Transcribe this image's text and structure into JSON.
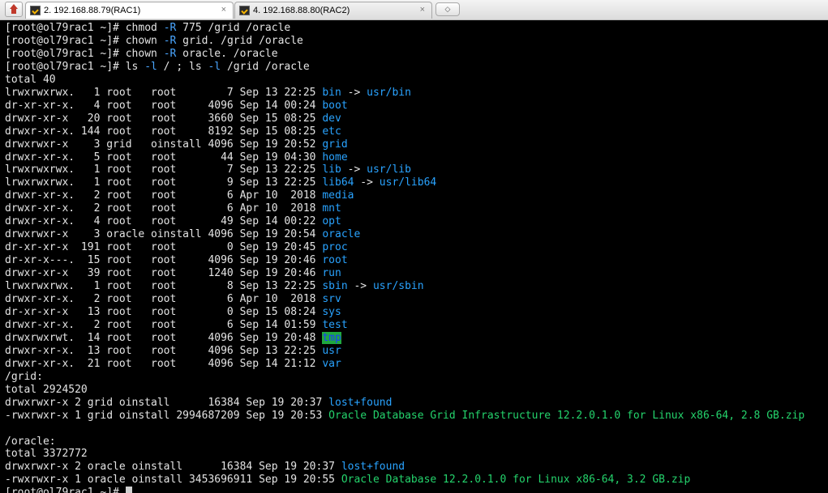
{
  "tabs": [
    {
      "label": "2. 192.168.88.79(RAC1)",
      "close": "×",
      "active": true
    },
    {
      "label": "4. 192.168.88.80(RAC2)",
      "close": "×",
      "active": false
    }
  ],
  "new_tab": "◇",
  "terminal": {
    "prompt": "[root@ol79rac1 ~]# ",
    "commands": [
      {
        "pre": "chmod ",
        "flag": "-R",
        "post": " 775 /grid /oracle"
      },
      {
        "pre": "chown ",
        "flag": "-R",
        "post": " grid. /grid /oracle"
      },
      {
        "pre": "chown ",
        "flag": "-R",
        "post": " oracle. /oracle"
      },
      {
        "pre": "ls ",
        "flag": "-l",
        "mid": " / ; ls ",
        "flag2": "-l",
        "post": " /grid /oracle"
      }
    ],
    "root_total": "total 40",
    "root_listing": [
      {
        "meta": "lrwxrwxrwx.   1 root   root        7 Sep 13 22:25 ",
        "name": "bin",
        "arrow": " -> ",
        "target": "usr/bin"
      },
      {
        "meta": "dr-xr-xr-x.   4 root   root     4096 Sep 14 00:24 ",
        "name": "boot"
      },
      {
        "meta": "drwxr-xr-x   20 root   root     3660 Sep 15 08:25 ",
        "name": "dev"
      },
      {
        "meta": "drwxr-xr-x. 144 root   root     8192 Sep 15 08:25 ",
        "name": "etc"
      },
      {
        "meta": "drwxrwxr-x    3 grid   oinstall 4096 Sep 19 20:52 ",
        "name": "grid"
      },
      {
        "meta": "drwxr-xr-x.   5 root   root       44 Sep 19 04:30 ",
        "name": "home"
      },
      {
        "meta": "lrwxrwxrwx.   1 root   root        7 Sep 13 22:25 ",
        "name": "lib",
        "arrow": " -> ",
        "target": "usr/lib"
      },
      {
        "meta": "lrwxrwxrwx.   1 root   root        9 Sep 13 22:25 ",
        "name": "lib64",
        "arrow": " -> ",
        "target": "usr/lib64"
      },
      {
        "meta": "drwxr-xr-x.   2 root   root        6 Apr 10  2018 ",
        "name": "media"
      },
      {
        "meta": "drwxr-xr-x.   2 root   root        6 Apr 10  2018 ",
        "name": "mnt"
      },
      {
        "meta": "drwxr-xr-x.   4 root   root       49 Sep 14 00:22 ",
        "name": "opt"
      },
      {
        "meta": "drwxrwxr-x    3 oracle oinstall 4096 Sep 19 20:54 ",
        "name": "oracle"
      },
      {
        "meta": "dr-xr-xr-x  191 root   root        0 Sep 19 20:45 ",
        "name": "proc"
      },
      {
        "meta": "dr-xr-x---.  15 root   root     4096 Sep 19 20:46 ",
        "name": "root"
      },
      {
        "meta": "drwxr-xr-x   39 root   root     1240 Sep 19 20:46 ",
        "name": "run"
      },
      {
        "meta": "lrwxrwxrwx.   1 root   root        8 Sep 13 22:25 ",
        "name": "sbin",
        "arrow": " -> ",
        "target": "usr/sbin"
      },
      {
        "meta": "drwxr-xr-x.   2 root   root        6 Apr 10  2018 ",
        "name": "srv"
      },
      {
        "meta": "dr-xr-xr-x   13 root   root        0 Sep 15 08:24 ",
        "name": "sys"
      },
      {
        "meta": "drwxr-xr-x.   2 root   root        6 Sep 14 01:59 ",
        "name": "test"
      },
      {
        "meta": "drwxrwxrwt.  14 root   root     4096 Sep 19 20:48 ",
        "name": "tmp",
        "sticky": true
      },
      {
        "meta": "drwxr-xr-x.  13 root   root     4096 Sep 13 22:25 ",
        "name": "usr"
      },
      {
        "meta": "drwxr-xr-x.  21 root   root     4096 Sep 14 21:12 ",
        "name": "var"
      }
    ],
    "grid_header": "/grid:",
    "grid_total": "total 2924520",
    "grid_listing": [
      {
        "meta": "drwxrwxr-x 2 grid oinstall      16384 Sep 19 20:37 ",
        "name": "lost+found",
        "kind": "dir"
      },
      {
        "meta": "-rwxrwxr-x 1 grid oinstall 2994687209 Sep 19 20:53 ",
        "name": "Oracle Database Grid Infrastructure 12.2.0.1.0 for Linux x86-64, 2.8 GB.zip",
        "kind": "zip"
      }
    ],
    "oracle_header": "/oracle:",
    "oracle_total": "total 3372772",
    "oracle_listing": [
      {
        "meta": "drwxrwxr-x 2 oracle oinstall      16384 Sep 19 20:37 ",
        "name": "lost+found",
        "kind": "dir"
      },
      {
        "meta": "-rwxrwxr-x 1 oracle oinstall 3453696911 Sep 19 20:55 ",
        "name": "Oracle Database 12.2.0.1.0 for Linux x86-64, 3.2 GB.zip",
        "kind": "zip"
      }
    ]
  },
  "colors": {
    "background": "#000000",
    "text": "#e4e4e4",
    "directory": "#29a3ff",
    "archive": "#24d36c",
    "sticky_bg": "#1fa83f"
  }
}
